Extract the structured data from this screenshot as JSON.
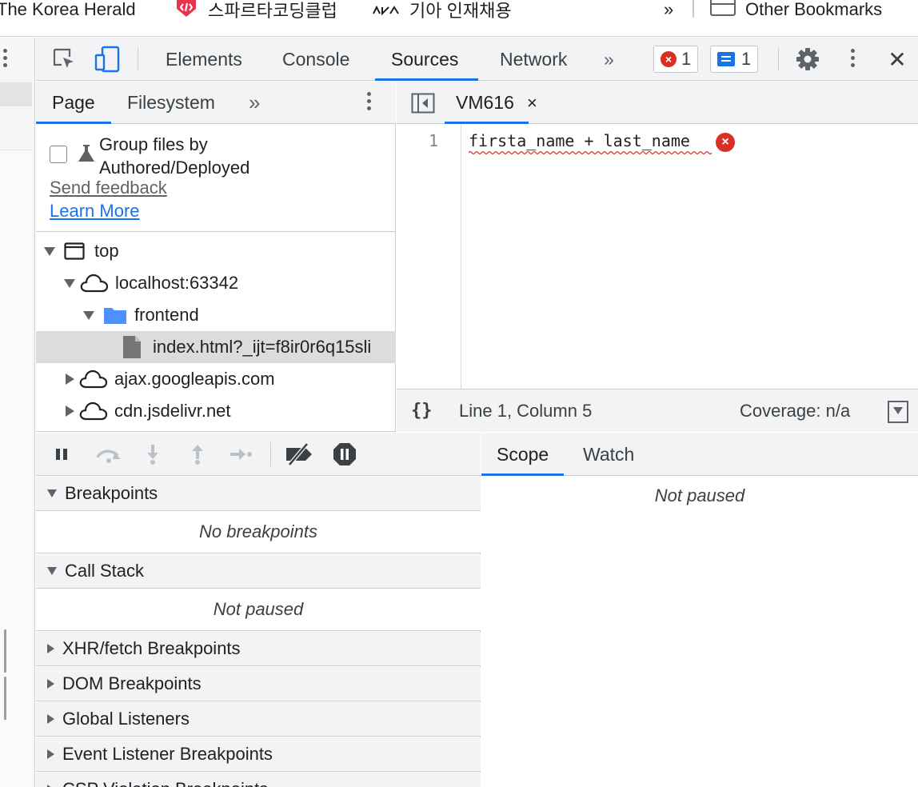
{
  "bookmarks": {
    "items": [
      {
        "label": "The Korea Herald"
      },
      {
        "label": "스파르타코딩클럽"
      },
      {
        "label": "기아 인재채용"
      }
    ],
    "overflow": "»",
    "other": "Other Bookmarks"
  },
  "toolbar": {
    "tabs": [
      "Elements",
      "Console",
      "Sources",
      "Network"
    ],
    "active_tab": "Sources",
    "more": "»",
    "errors_count": "1",
    "messages_count": "1",
    "error_mark": "×",
    "close": "✕"
  },
  "navigator": {
    "tabs": [
      "Page",
      "Filesystem"
    ],
    "active_tab": "Page",
    "more": "»",
    "group_label": "Group files by Authored/Deployed",
    "send_feedback": "Send feedback",
    "learn_more": "Learn More",
    "tree": [
      {
        "label": "top",
        "type": "frame",
        "expanded": true
      },
      {
        "label": "localhost:63342",
        "type": "origin",
        "expanded": true
      },
      {
        "label": "frontend",
        "type": "folder",
        "expanded": true
      },
      {
        "label": "index.html?_ijt=f8ir0r6q15sli",
        "type": "file",
        "selected": true
      },
      {
        "label": "ajax.googleapis.com",
        "type": "origin",
        "expanded": false
      },
      {
        "label": "cdn.jsdelivr.net",
        "type": "origin",
        "expanded": false
      }
    ]
  },
  "editor": {
    "tab_label": "VM616",
    "tab_close": "×",
    "line_number": "1",
    "code": "firsta_name + last_name",
    "error_mark": "×",
    "status": {
      "braces": "{}",
      "position": "Line 1, Column 5",
      "coverage": "Coverage: n/a"
    }
  },
  "debugger": {
    "sections": [
      {
        "title": "Breakpoints",
        "expanded": true,
        "body": "No breakpoints"
      },
      {
        "title": "Call Stack",
        "expanded": true,
        "body": "Not paused"
      },
      {
        "title": "XHR/fetch Breakpoints",
        "expanded": false
      },
      {
        "title": "DOM Breakpoints",
        "expanded": false
      },
      {
        "title": "Global Listeners",
        "expanded": false
      },
      {
        "title": "Event Listener Breakpoints",
        "expanded": false
      },
      {
        "title": "CSP Violation Breakpoints",
        "expanded": false
      }
    ]
  },
  "scope": {
    "tabs": [
      "Scope",
      "Watch"
    ],
    "active_tab": "Scope",
    "body": "Not paused"
  },
  "colors": {
    "accent": "#1a73e8",
    "error": "#d93025",
    "toolbar_bg": "#f1f3f4",
    "border": "#cbcdd1"
  }
}
